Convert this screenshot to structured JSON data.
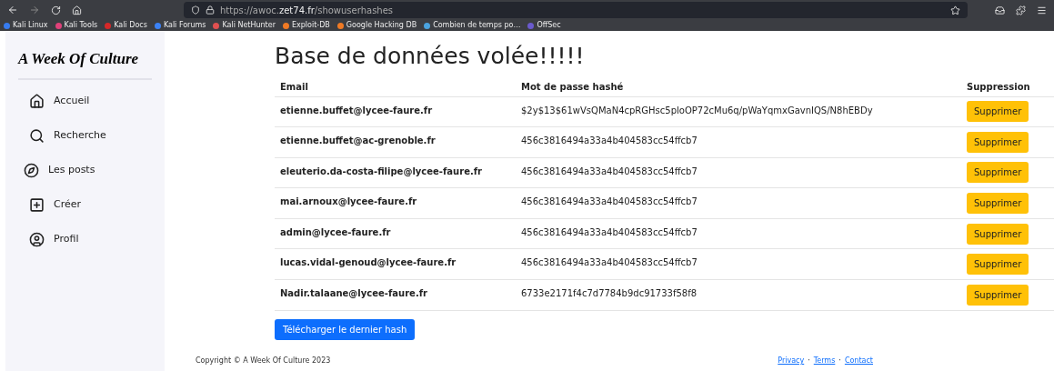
{
  "browser": {
    "url_host_pre": "https://awoc.",
    "url_host": "zet74.fr",
    "url_path": "/showuserhashes"
  },
  "bookmarks": [
    {
      "label": "Kali Linux",
      "color": "#367bf0"
    },
    {
      "label": "Kali Tools",
      "color": "#e0417a"
    },
    {
      "label": "Kali Docs",
      "color": "#d62828"
    },
    {
      "label": "Kali Forums",
      "color": "#3b82f6"
    },
    {
      "label": "Kali NetHunter",
      "color": "#e05050"
    },
    {
      "label": "Exploit-DB",
      "color": "#f07a24"
    },
    {
      "label": "Google Hacking DB",
      "color": "#f07a24"
    },
    {
      "label": "Combien de temps po…",
      "color": "#4aa3df"
    },
    {
      "label": "OffSec",
      "color": "#6a5acd"
    }
  ],
  "sidebar": {
    "logo": "A Week Of Culture",
    "items": [
      {
        "label": "Accueil"
      },
      {
        "label": "Recherche"
      },
      {
        "label": "Les posts"
      },
      {
        "label": "Créer"
      },
      {
        "label": "Profil"
      }
    ]
  },
  "title": "Base de données volée!!!!!",
  "table": {
    "columns": [
      "Email",
      "Mot de passe hashé",
      "Suppression"
    ],
    "rows": [
      {
        "email": "etienne.buffet@lycee-faure.fr",
        "hash": "$2y$13$61wVsQMaN4cpRGHsc5ploOP72cMu6q/pWaYqmxGavnIQS/N8hEBDy",
        "action": "Supprimer"
      },
      {
        "email": "etienne.buffet@ac-grenoble.fr",
        "hash": "456c3816494a33a4b404583cc54ffcb7",
        "action": "Supprimer"
      },
      {
        "email": "eleuterio.da-costa-filipe@lycee-faure.fr",
        "hash": "456c3816494a33a4b404583cc54ffcb7",
        "action": "Supprimer"
      },
      {
        "email": "mai.arnoux@lycee-faure.fr",
        "hash": "456c3816494a33a4b404583cc54ffcb7",
        "action": "Supprimer"
      },
      {
        "email": "admin@lycee-faure.fr",
        "hash": "456c3816494a33a4b404583cc54ffcb7",
        "action": "Supprimer"
      },
      {
        "email": "lucas.vidal-genoud@lycee-faure.fr",
        "hash": "456c3816494a33a4b404583cc54ffcb7",
        "action": "Supprimer"
      },
      {
        "email": "Nadir.talaane@lycee-faure.fr",
        "hash": "6733e2171f4c7d7784b9dc91733f58f8",
        "action": "Supprimer"
      }
    ]
  },
  "download_button": "Télécharger le dernier hash",
  "footer": {
    "copyright": "Copyright © A Week Of Culture 2023",
    "links": [
      "Privacy",
      "Terms",
      "Contact"
    ],
    "separators": [
      "·",
      "·"
    ]
  }
}
